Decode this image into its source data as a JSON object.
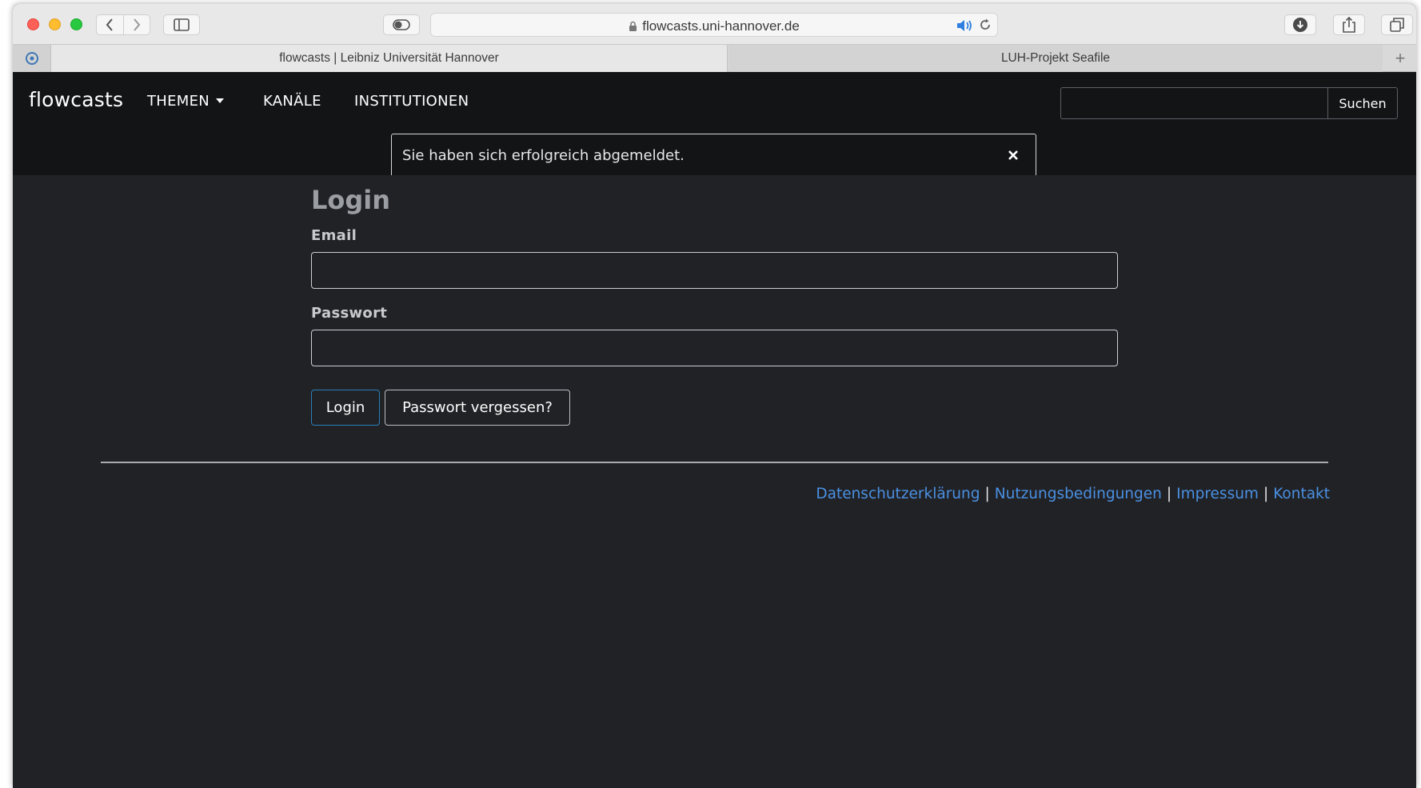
{
  "browser": {
    "url": "flowcasts.uni-hannover.de",
    "tabs": [
      {
        "label": "flowcasts | Leibniz Universität Hannover",
        "active": true
      },
      {
        "label": "LUH-Projekt Seafile",
        "active": false
      }
    ],
    "new_tab_label": "+"
  },
  "navbar": {
    "brand": "flowcasts",
    "links": [
      "THEMEN",
      "KANÄLE",
      "INSTITUTIONEN"
    ],
    "search_button": "Suchen",
    "search_value": ""
  },
  "alert": {
    "message": "Sie haben sich erfolgreich abgemeldet."
  },
  "login": {
    "title": "Login",
    "email_label": "Email",
    "email_value": "",
    "password_label": "Passwort",
    "password_value": "",
    "submit_label": "Login",
    "forgot_label": "Passwort vergessen?"
  },
  "footer": {
    "links": [
      "Datenschutzerklärung",
      "Nutzungsbedingungen",
      "Impressum",
      "Kontakt"
    ],
    "separator": "|"
  },
  "colors": {
    "page_bg": "#212226",
    "navbar_bg": "#121416",
    "link": "#4a90e2",
    "login_button_border": "#2a80b9"
  }
}
